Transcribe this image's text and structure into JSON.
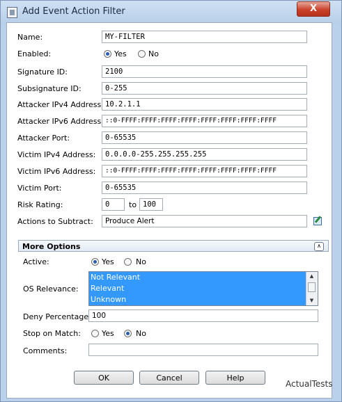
{
  "window": {
    "title": "Add Event Action Filter",
    "close_label": "X"
  },
  "form": {
    "name_label": "Name:",
    "name_value": "MY-FILTER",
    "enabled_label": "Enabled:",
    "enabled_yes": "Yes",
    "enabled_no": "No",
    "enabled_selected": "Yes",
    "signature_id_label": "Signature ID:",
    "signature_id_value": "2100",
    "subsignature_id_label": "Subsignature ID:",
    "subsignature_id_value": "0-255",
    "attacker_ipv4_label": "Attacker IPv4 Address:",
    "attacker_ipv4_value": "10.2.1.1",
    "attacker_ipv6_label": "Attacker IPv6 Address:",
    "attacker_ipv6_value": "::0-FFFF:FFFF:FFFF:FFFF:FFFF:FFFF:FFFF:FFFF",
    "attacker_port_label": "Attacker Port:",
    "attacker_port_value": "0-65535",
    "victim_ipv4_label": "Victim IPv4 Address:",
    "victim_ipv4_value": "0.0.0.0-255.255.255.255",
    "victim_ipv6_label": "Victim IPv6 Address:",
    "victim_ipv6_value": "::0-FFFF:FFFF:FFFF:FFFF:FFFF:FFFF:FFFF:FFFF",
    "victim_port_label": "Victim Port:",
    "victim_port_value": "0-65535",
    "risk_rating_label": "Risk Rating:",
    "risk_min": "0",
    "risk_to": "to",
    "risk_max": "100",
    "actions_label": "Actions to Subtract:",
    "actions_value": "Produce Alert"
  },
  "more_options": {
    "title": "More Options",
    "active_label": "Active:",
    "active_yes": "Yes",
    "active_no": "No",
    "active_selected": "Yes",
    "os_relevance_label": "OS Relevance:",
    "os_relevance_items": [
      "Not Relevant",
      "Relevant",
      "Unknown"
    ],
    "deny_percentage_label": "Deny Percentage:",
    "deny_percentage_value": "100",
    "stop_on_match_label": "Stop on Match:",
    "stop_yes": "Yes",
    "stop_no": "No",
    "stop_selected": "No",
    "comments_label": "Comments:",
    "comments_value": ""
  },
  "buttons": {
    "ok": "OK",
    "cancel": "Cancel",
    "help": "Help"
  },
  "icons": {
    "title": "window-icon",
    "edit": "edit-icon",
    "collapse": "collapse-icon"
  },
  "watermark": "ActualTests"
}
